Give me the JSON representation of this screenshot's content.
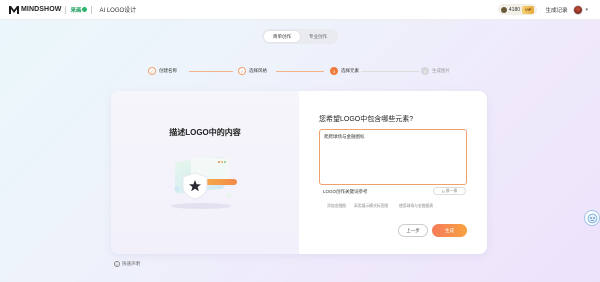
{
  "header": {
    "brand": "MINDSHOW",
    "partner": "来画",
    "app_title": "AI LOGO设计",
    "credits": "4180",
    "vip": "VIP",
    "history_label": "生成记录",
    "logo_color": "#1a1a1a",
    "partner_color": "#1a9e5c"
  },
  "mode_toggle": {
    "options": [
      "简单创作",
      "专业创作"
    ],
    "selected": "简单创作"
  },
  "steps": [
    {
      "num": "1",
      "label": "创建名称",
      "state": "done"
    },
    {
      "num": "2",
      "label": "选择风格",
      "state": "done"
    },
    {
      "num": "3",
      "label": "选择元素",
      "state": "current"
    },
    {
      "num": "4",
      "label": "生成图片",
      "state": "todo"
    }
  ],
  "left_panel": {
    "title": "描述LOGO中的内容",
    "illustration": "star-shield-illustration"
  },
  "right_panel": {
    "question": "您希望LOGO中包含哪些元素?",
    "input_value": "爬爬球场与金融图标",
    "tags_title": "LOGO创作关键词参考",
    "refresh_label": "换一换",
    "tags": [
      "添加金融图",
      "采用展示模式标签图",
      "使用球场与金融图表"
    ],
    "prev_label": "上一步",
    "generate_label": "生成"
  },
  "footer": {
    "help_label": "快速声明"
  },
  "colors": {
    "accent": "#f07a3a",
    "accent_border": "#f0a070",
    "generate_gradient_start": "#f57a5a",
    "generate_gradient_end": "#f7a240"
  }
}
